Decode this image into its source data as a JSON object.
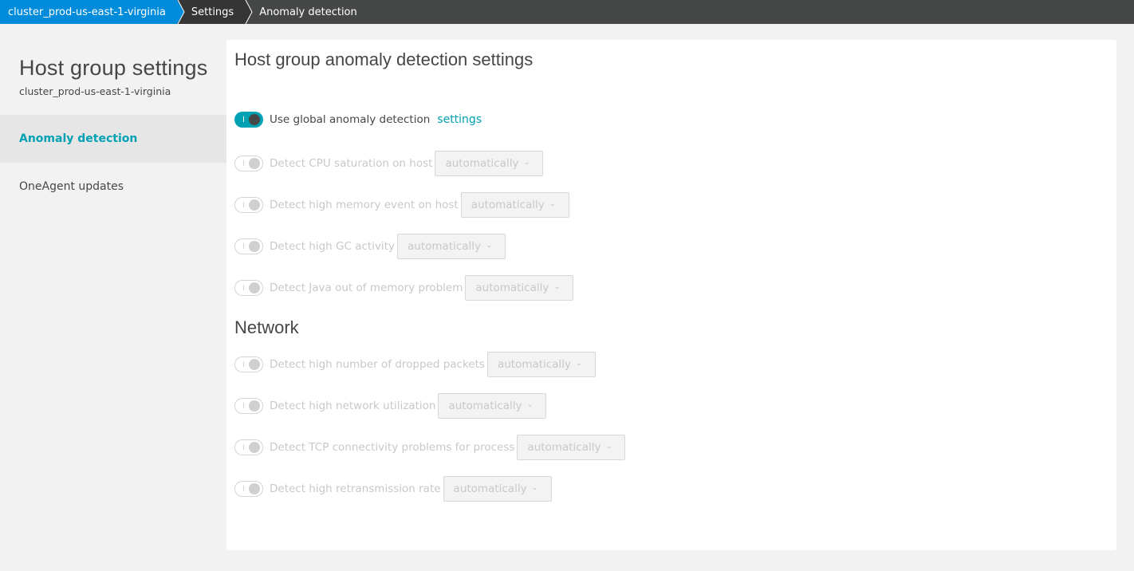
{
  "breadcrumb": [
    {
      "label": "cluster_prod-us-east-1-virginia"
    },
    {
      "label": "Settings"
    },
    {
      "label": "Anomaly detection"
    }
  ],
  "colors": {
    "accent": "#00a1b2",
    "breadcrumb_primary": "#008cdb",
    "breadcrumb_dark": "#353535",
    "topbar": "#454646"
  },
  "sidebar": {
    "title": "Host group settings",
    "subtitle": "cluster_prod-us-east-1-virginia",
    "items": [
      {
        "label": "Anomaly detection",
        "active": true
      },
      {
        "label": "OneAgent updates",
        "active": false
      }
    ]
  },
  "main": {
    "title": "Host group anomaly detection settings",
    "global": {
      "label": "Use global anomaly detection",
      "link": "settings",
      "enabled": true
    },
    "host_settings": [
      {
        "label": "Detect CPU saturation on host",
        "value": "automatically",
        "icon": "chevron-down-icon"
      },
      {
        "label": "Detect high memory event on host",
        "value": "automatically",
        "icon": "chevron-down-icon"
      },
      {
        "label": "Detect high GC activity",
        "value": "automatically",
        "icon": "chevron-down-icon"
      },
      {
        "label": "Detect Java out of memory problem",
        "value": "automatically",
        "icon": "chevron-down-icon"
      }
    ],
    "network_title": "Network",
    "network_settings": [
      {
        "label": "Detect high number of dropped packets",
        "value": "automatically",
        "icon": "chevron-down-icon"
      },
      {
        "label": "Detect high network utilization",
        "value": "automatically",
        "icon": "chevron-down-icon"
      },
      {
        "label": "Detect TCP connectivity problems for process",
        "value": "automatically",
        "icon": "chevron-down-icon"
      },
      {
        "label": "Detect high retransmission rate",
        "value": "automatically",
        "icon": "chevron-down-icon"
      }
    ]
  }
}
